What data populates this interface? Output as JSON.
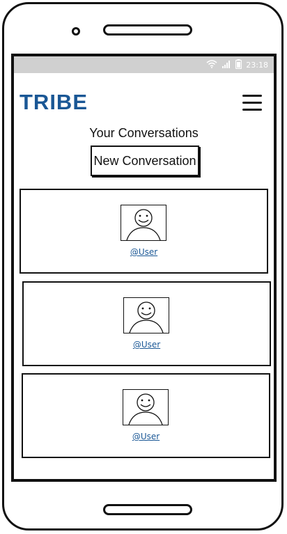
{
  "status_bar": {
    "time": "23:18",
    "icons": [
      "wifi-icon",
      "signal-icon",
      "battery-icon"
    ]
  },
  "header": {
    "logo_text": "TRIBE",
    "menu_icon": "hamburger-menu-icon"
  },
  "main": {
    "title": "Your Conversations",
    "new_conversation_label": "New Conversation",
    "conversations": [
      {
        "user_label": "@User",
        "avatar_icon": "user-avatar-icon"
      },
      {
        "user_label": "@User",
        "avatar_icon": "user-avatar-icon"
      },
      {
        "user_label": "@User",
        "avatar_icon": "user-avatar-icon"
      }
    ]
  },
  "colors": {
    "brand": "#1a5795",
    "status_bar": "#d0d0d0",
    "outline": "#111111"
  }
}
